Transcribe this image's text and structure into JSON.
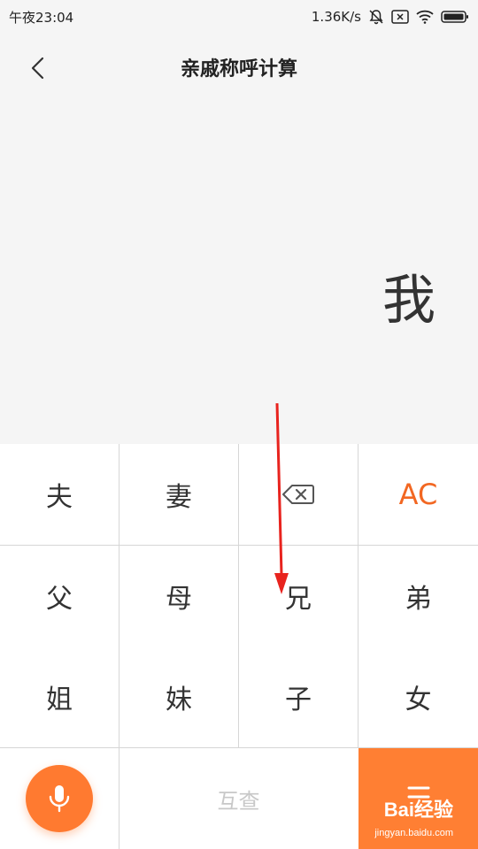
{
  "status_bar": {
    "time": "午夜23:04",
    "network_speed": "1.36K/s"
  },
  "header": {
    "title": "亲戚称呼计算"
  },
  "display": {
    "result": "我"
  },
  "keypad": {
    "row1": [
      "夫",
      "妻",
      "",
      "AC"
    ],
    "row2": [
      "父",
      "母",
      "兄",
      "弟"
    ],
    "row3": [
      "姐",
      "妹",
      "子",
      "女"
    ],
    "query_label": "互查"
  },
  "watermark": {
    "logo": "Bai经验",
    "url": "jingyan.baidu.com"
  },
  "colors": {
    "accent": "#ff7f33",
    "background": "#f5f5f5",
    "annotation_arrow": "#e8231e"
  },
  "icons": [
    "back-icon",
    "mute-bell-icon",
    "sim-x-icon",
    "wifi-icon",
    "battery-icon",
    "backspace-icon",
    "microphone-icon",
    "equals-icon"
  ]
}
